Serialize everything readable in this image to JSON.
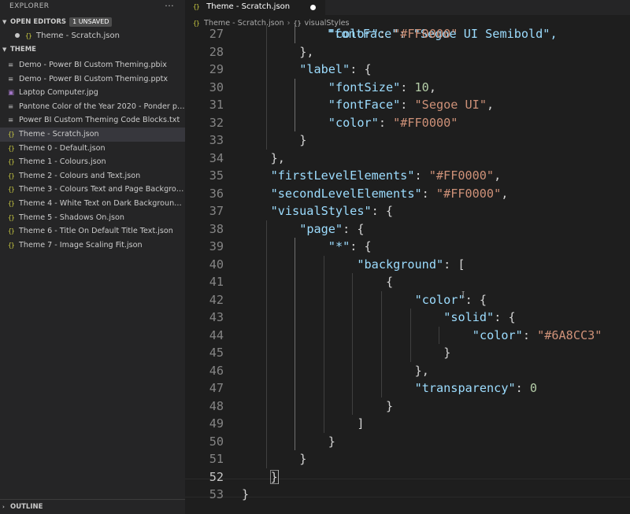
{
  "sidebar": {
    "title": "EXPLORER",
    "more_icon": "ellipsis-icon",
    "open_editors": {
      "title": "OPEN EDITORS",
      "badge": "1 UNSAVED",
      "items": [
        {
          "label": "Theme - Scratch.json",
          "icon": "{}"
        }
      ]
    },
    "theme": {
      "title": "THEME",
      "files": [
        {
          "label": "Demo - Power BI Custom Theming.pbix",
          "icon": "≡",
          "kind": "doc"
        },
        {
          "label": "Demo - Power BI Custom Theming.pptx",
          "icon": "≡",
          "kind": "doc"
        },
        {
          "label": "Laptop Computer.jpg",
          "icon": "▣",
          "kind": "img"
        },
        {
          "label": "Pantone Color of the Year 2020 - Ponder pa...",
          "icon": "≡",
          "kind": "doc"
        },
        {
          "label": "Power BI Custom Theming Code Blocks.txt",
          "icon": "≡",
          "kind": "doc"
        },
        {
          "label": "Theme - Scratch.json",
          "icon": "{}",
          "kind": "json",
          "active": true
        },
        {
          "label": "Theme 0 - Default.json",
          "icon": "{}",
          "kind": "json"
        },
        {
          "label": "Theme 1 - Colours.json",
          "icon": "{}",
          "kind": "json"
        },
        {
          "label": "Theme 2 - Colours and Text.json",
          "icon": "{}",
          "kind": "json"
        },
        {
          "label": "Theme 3 - Colours Text and Page Backgrou...",
          "icon": "{}",
          "kind": "json"
        },
        {
          "label": "Theme 4 - White Text on Dark Background.j...",
          "icon": "{}",
          "kind": "json"
        },
        {
          "label": "Theme 5 - Shadows On.json",
          "icon": "{}",
          "kind": "json"
        },
        {
          "label": "Theme 6 - Title On Default Title Text.json",
          "icon": "{}",
          "kind": "json"
        },
        {
          "label": "Theme 7 - Image Scaling Fit.json",
          "icon": "{}",
          "kind": "json"
        }
      ]
    },
    "outline_title": "OUTLINE"
  },
  "editor": {
    "tab": {
      "label": "Theme - Scratch.json",
      "icon": "{}"
    },
    "breadcrumb": [
      "Theme - Scratch.json",
      "visualStyles"
    ],
    "breadcrumb_icon": "{}",
    "lines": [
      {
        "n": "27",
        "indent": 3,
        "tokens": [
          [
            "k",
            "\"color\""
          ],
          [
            "p",
            ": "
          ],
          [
            "s",
            "\"#FF0000\""
          ]
        ]
      },
      {
        "n": "28",
        "indent": 2,
        "tokens": [
          [
            "p",
            "},"
          ]
        ]
      },
      {
        "n": "29",
        "indent": 2,
        "tokens": [
          [
            "k",
            "\"label\""
          ],
          [
            "p",
            ": {"
          ]
        ]
      },
      {
        "n": "30",
        "indent": 3,
        "tokens": [
          [
            "k",
            "\"fontSize\""
          ],
          [
            "p",
            ": "
          ],
          [
            "n",
            "10"
          ],
          [
            "p",
            ","
          ]
        ]
      },
      {
        "n": "31",
        "indent": 3,
        "tokens": [
          [
            "k",
            "\"fontFace\""
          ],
          [
            "p",
            ": "
          ],
          [
            "s",
            "\"Segoe UI\""
          ],
          [
            "p",
            ","
          ]
        ]
      },
      {
        "n": "32",
        "indent": 3,
        "tokens": [
          [
            "k",
            "\"color\""
          ],
          [
            "p",
            ": "
          ],
          [
            "s",
            "\"#FF0000\""
          ]
        ]
      },
      {
        "n": "33",
        "indent": 2,
        "tokens": [
          [
            "p",
            "}"
          ]
        ]
      },
      {
        "n": "34",
        "indent": 1,
        "tokens": [
          [
            "p",
            "},"
          ]
        ]
      },
      {
        "n": "35",
        "indent": 1,
        "tokens": [
          [
            "k",
            "\"firstLevelElements\""
          ],
          [
            "p",
            ": "
          ],
          [
            "s",
            "\"#FF0000\""
          ],
          [
            "p",
            ","
          ]
        ]
      },
      {
        "n": "36",
        "indent": 1,
        "tokens": [
          [
            "k",
            "\"secondLevelElements\""
          ],
          [
            "p",
            ": "
          ],
          [
            "s",
            "\"#FF0000\""
          ],
          [
            "p",
            ","
          ]
        ]
      },
      {
        "n": "37",
        "indent": 1,
        "tokens": [
          [
            "k",
            "\"visualStyles\""
          ],
          [
            "p",
            ": {"
          ]
        ]
      },
      {
        "n": "38",
        "indent": 2,
        "tokens": [
          [
            "k",
            "\"page\""
          ],
          [
            "p",
            ": {"
          ]
        ]
      },
      {
        "n": "39",
        "indent": 3,
        "tokens": [
          [
            "k",
            "\"*\""
          ],
          [
            "p",
            ": {"
          ]
        ]
      },
      {
        "n": "40",
        "indent": 4,
        "tokens": [
          [
            "k",
            "\"background\""
          ],
          [
            "p",
            ": ["
          ]
        ]
      },
      {
        "n": "41",
        "indent": 5,
        "tokens": [
          [
            "p",
            "{"
          ]
        ]
      },
      {
        "n": "42",
        "indent": 6,
        "tokens": [
          [
            "k",
            "\"color\""
          ],
          [
            "p",
            ": {"
          ]
        ]
      },
      {
        "n": "43",
        "indent": 7,
        "tokens": [
          [
            "k",
            "\"solid\""
          ],
          [
            "p",
            ": {"
          ]
        ]
      },
      {
        "n": "44",
        "indent": 8,
        "tokens": [
          [
            "k",
            "\"color\""
          ],
          [
            "p",
            ": "
          ],
          [
            "s",
            "\"#6A8CC3\""
          ]
        ]
      },
      {
        "n": "45",
        "indent": 7,
        "tokens": [
          [
            "p",
            "}"
          ]
        ]
      },
      {
        "n": "46",
        "indent": 6,
        "tokens": [
          [
            "p",
            "},"
          ]
        ]
      },
      {
        "n": "47",
        "indent": 6,
        "tokens": [
          [
            "k",
            "\"transparency\""
          ],
          [
            "p",
            ": "
          ],
          [
            "n",
            "0"
          ]
        ]
      },
      {
        "n": "48",
        "indent": 5,
        "tokens": [
          [
            "p",
            "}"
          ]
        ]
      },
      {
        "n": "49",
        "indent": 4,
        "tokens": [
          [
            "p",
            "]"
          ]
        ]
      },
      {
        "n": "50",
        "indent": 3,
        "tokens": [
          [
            "p",
            "}"
          ]
        ]
      },
      {
        "n": "51",
        "indent": 2,
        "tokens": [
          [
            "p",
            "}"
          ]
        ]
      },
      {
        "n": "52",
        "indent": 1,
        "tokens": [
          [
            "p",
            "}"
          ]
        ],
        "current": true
      },
      {
        "n": "53",
        "indent": 0,
        "tokens": [
          [
            "p",
            "}"
          ]
        ]
      }
    ],
    "partial_top_line": "\"fontFace\": \"Segoe UI Semibold\","
  },
  "colors": {
    "key": "#9cdcfe",
    "string": "#ce9178",
    "number": "#b5cea8",
    "punct": "#d4d4d4",
    "line_number": "#858585",
    "json_icon": "#cbcb41"
  }
}
